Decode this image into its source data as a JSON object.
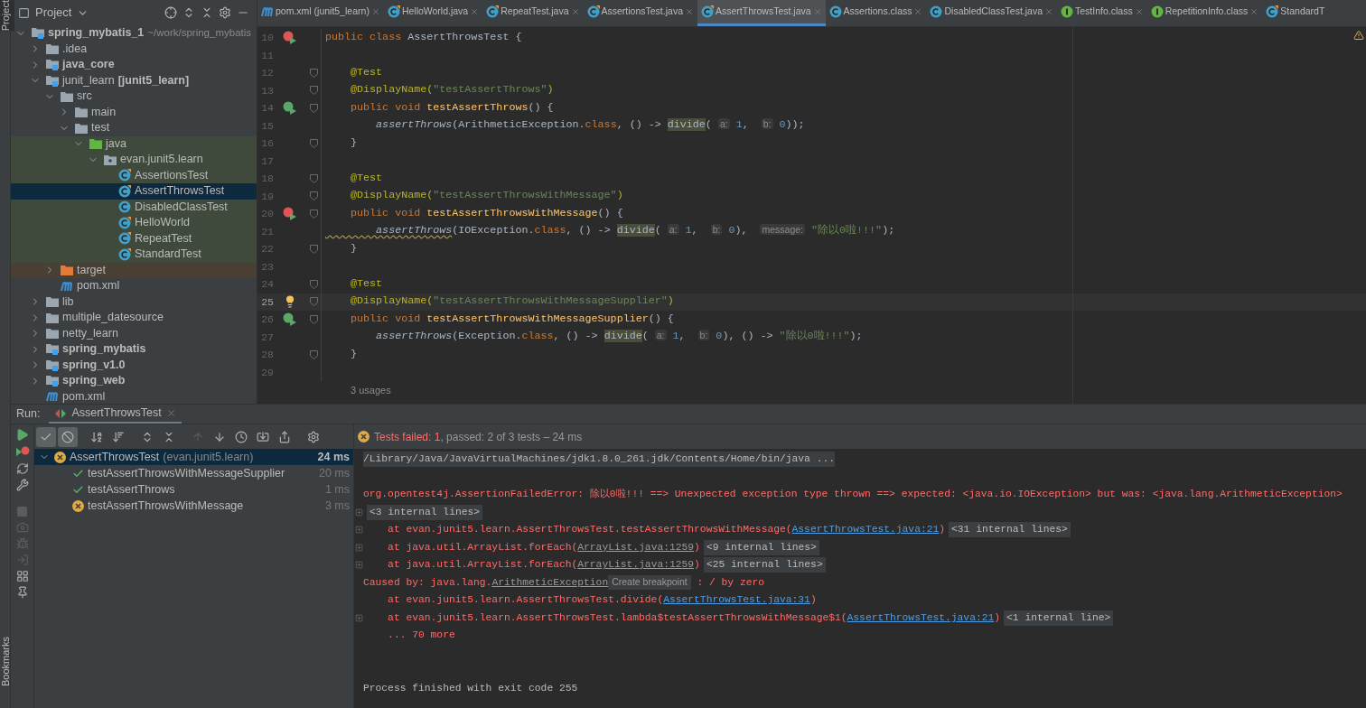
{
  "side_tools": {
    "top": "Project",
    "bottom": "Bookmarks"
  },
  "project_panel": {
    "title": "Project"
  },
  "project_tree": [
    {
      "name": "spring_mybatis_1",
      "suffix": "~/work/spring_mybatis",
      "kind": "module",
      "bold": true,
      "expanded": true,
      "selected": false,
      "children": [
        {
          "name": ".idea",
          "kind": "folder",
          "expanded": false,
          "selected": false
        },
        {
          "name": "java_core",
          "kind": "module",
          "bold": true,
          "expanded": false,
          "selected": false
        },
        {
          "name": "junit_learn",
          "suffix": "[junit5_learn]",
          "kind": "module",
          "expanded": true,
          "selected": false,
          "children": [
            {
              "name": "src",
              "kind": "folder",
              "expanded": true,
              "selected": false,
              "children": [
                {
                  "name": "main",
                  "kind": "folder",
                  "expanded": false,
                  "selected": false
                },
                {
                  "name": "test",
                  "kind": "folder",
                  "expanded": true,
                  "selected": false,
                  "children": [
                    {
                      "name": "java",
                      "kind": "test-folder",
                      "test_source": true,
                      "expanded": true,
                      "selected": false,
                      "children": [
                        {
                          "name": "evan.junit5.learn",
                          "kind": "package",
                          "test_source": true,
                          "expanded": true,
                          "selected": false,
                          "children": [
                            {
                              "name": "AssertionsTest",
                              "kind": "test-class",
                              "test_source": true,
                              "selected": false
                            },
                            {
                              "name": "AssertThrowsTest",
                              "kind": "test-class",
                              "test_source": true,
                              "selected": true
                            },
                            {
                              "name": "DisabledClassTest",
                              "kind": "class",
                              "test_source": true,
                              "selected": false
                            },
                            {
                              "name": "HelloWorld",
                              "kind": "test-class",
                              "test_source": true,
                              "selected": false
                            },
                            {
                              "name": "RepeatTest",
                              "kind": "test-class",
                              "test_source": true,
                              "selected": false
                            },
                            {
                              "name": "StandardTest",
                              "kind": "test-class",
                              "test_source": true,
                              "selected": false
                            }
                          ]
                        }
                      ]
                    }
                  ]
                }
              ]
            },
            {
              "name": "target",
              "kind": "excluded-folder",
              "excluded": true,
              "expanded": false,
              "selected": false
            },
            {
              "name": "pom.xml",
              "kind": "maven",
              "selected": false
            }
          ]
        },
        {
          "name": "lib",
          "kind": "folder",
          "expanded": false,
          "selected": false
        },
        {
          "name": "multiple_datesource",
          "kind": "folder",
          "expanded": false,
          "selected": false
        },
        {
          "name": "netty_learn",
          "kind": "folder",
          "expanded": false,
          "selected": false
        },
        {
          "name": "spring_mybatis",
          "kind": "module",
          "bold": true,
          "expanded": false,
          "selected": false
        },
        {
          "name": "spring_v1.0",
          "kind": "module",
          "bold": true,
          "expanded": false,
          "selected": false
        },
        {
          "name": "spring_web",
          "kind": "module",
          "bold": true,
          "expanded": false,
          "selected": false
        },
        {
          "name": "pom.xml",
          "kind": "maven",
          "selected": false
        }
      ]
    }
  ],
  "tabs": [
    {
      "label": "pom.xml (junit5_learn)",
      "kind": "maven",
      "selected": false
    },
    {
      "label": "HelloWorld.java",
      "kind": "test-class",
      "selected": false
    },
    {
      "label": "RepeatTest.java",
      "kind": "test-class",
      "selected": false
    },
    {
      "label": "AssertionsTest.java",
      "kind": "test-class",
      "selected": false
    },
    {
      "label": "AssertThrowsTest.java",
      "kind": "test-class",
      "selected": true
    },
    {
      "label": "Assertions.class",
      "kind": "class",
      "selected": false
    },
    {
      "label": "DisabledClassTest.java",
      "kind": "class",
      "selected": false
    },
    {
      "label": "TestInfo.class",
      "kind": "interface",
      "selected": false
    },
    {
      "label": "RepetitionInfo.class",
      "kind": "interface",
      "selected": false
    },
    {
      "label": "StandardT",
      "kind": "test-class",
      "selected": false
    }
  ],
  "editor": {
    "lines": [
      {
        "number": "10",
        "gutter": {
          "kind": "run-failed"
        },
        "tokens": [
          {
            "text": "public class ",
            "kind": "kw"
          },
          {
            "text": "AssertThrowsTest {",
            "kind": "plain"
          }
        ]
      },
      {
        "number": "11"
      },
      {
        "number": "12",
        "fold": true,
        "tokens": [
          {
            "text": "    @Test",
            "kind": "ann"
          }
        ]
      },
      {
        "number": "13",
        "fold": true,
        "tokens": [
          {
            "text": "    @DisplayName(",
            "kind": "ann"
          },
          {
            "text": "\"testAssertThrows\"",
            "kind": "str"
          },
          {
            "text": ")",
            "kind": "ann"
          }
        ]
      },
      {
        "number": "14",
        "gutter": {
          "kind": "run-passed"
        },
        "fold": true,
        "tokens": [
          {
            "text": "    public void ",
            "kind": "kw"
          },
          {
            "text": "testAssertThrows",
            "kind": "fn"
          },
          {
            "text": "() {",
            "kind": "plain"
          }
        ]
      },
      {
        "number": "15",
        "tokens": [
          {
            "text": "        assertThrows",
            "kind": "call"
          },
          {
            "text": "(ArithmeticException.",
            "kind": "plain"
          },
          {
            "text": "class",
            "kind": "kw"
          },
          {
            "text": ", () -> ",
            "kind": "plain"
          },
          {
            "text": "divide",
            "kind": "hl"
          },
          {
            "text": "( ",
            "kind": "plain"
          },
          {
            "text": "a:",
            "kind": "hint"
          },
          {
            "text": " 1",
            "kind": "num"
          },
          {
            "text": ",  ",
            "kind": "plain"
          },
          {
            "text": "b:",
            "kind": "hint"
          },
          {
            "text": " 0",
            "kind": "num"
          },
          {
            "text": "));",
            "kind": "plain"
          }
        ]
      },
      {
        "number": "16",
        "fold": true,
        "tokens": [
          {
            "text": "    }",
            "kind": "plain"
          }
        ]
      },
      {
        "number": "17"
      },
      {
        "number": "18",
        "fold": true,
        "tokens": [
          {
            "text": "    @Test",
            "kind": "ann"
          }
        ]
      },
      {
        "number": "19",
        "fold": true,
        "tokens": [
          {
            "text": "    @DisplayName(",
            "kind": "ann"
          },
          {
            "text": "\"testAssertThrowsWithMessage\"",
            "kind": "str"
          },
          {
            "text": ")",
            "kind": "ann"
          }
        ]
      },
      {
        "number": "20",
        "gutter": {
          "kind": "run-failed"
        },
        "fold": true,
        "tokens": [
          {
            "text": "    public void ",
            "kind": "kw"
          },
          {
            "text": "testAssertThrowsWithMessage",
            "kind": "fn"
          },
          {
            "text": "() {",
            "kind": "plain"
          }
        ]
      },
      {
        "number": "21",
        "tokens": [
          {
            "text": "        assertThrows",
            "kind": "call-warn"
          },
          {
            "text": "(IOException.",
            "kind": "plain"
          },
          {
            "text": "class",
            "kind": "kw"
          },
          {
            "text": ", () -> ",
            "kind": "plain"
          },
          {
            "text": "divide",
            "kind": "hl"
          },
          {
            "text": "( ",
            "kind": "plain"
          },
          {
            "text": "a:",
            "kind": "hint"
          },
          {
            "text": " 1",
            "kind": "num"
          },
          {
            "text": ",  ",
            "kind": "plain"
          },
          {
            "text": "b:",
            "kind": "hint"
          },
          {
            "text": " 0",
            "kind": "num"
          },
          {
            "text": "),  ",
            "kind": "plain"
          },
          {
            "text": "message:",
            "kind": "hint"
          },
          {
            "text": " \"除以0啦!!!\"",
            "kind": "str"
          },
          {
            "text": ");",
            "kind": "plain"
          }
        ]
      },
      {
        "number": "22",
        "fold": true,
        "tokens": [
          {
            "text": "    }",
            "kind": "plain"
          }
        ]
      },
      {
        "number": "23"
      },
      {
        "number": "24",
        "fold": true,
        "tokens": [
          {
            "text": "    @Test",
            "kind": "ann"
          }
        ]
      },
      {
        "number": "25",
        "gutter": {
          "kind": "bulb"
        },
        "current": true,
        "fold": true,
        "tokens": [
          {
            "text": "    @DisplayName(",
            "kind": "ann"
          },
          {
            "text": "\"testAssertThrowsWithMessageSupplier\"",
            "kind": "str"
          },
          {
            "text": ")",
            "kind": "ann"
          }
        ]
      },
      {
        "number": "26",
        "gutter": {
          "kind": "run-passed"
        },
        "fold": true,
        "tokens": [
          {
            "text": "    public void ",
            "kind": "kw"
          },
          {
            "text": "testAssertThrowsWithMessageSupplier",
            "kind": "fn"
          },
          {
            "text": "() {",
            "kind": "plain"
          }
        ]
      },
      {
        "number": "27",
        "tokens": [
          {
            "text": "        assertThrows",
            "kind": "call"
          },
          {
            "text": "(Exception.",
            "kind": "plain"
          },
          {
            "text": "class",
            "kind": "kw"
          },
          {
            "text": ", () -> ",
            "kind": "plain"
          },
          {
            "text": "divide",
            "kind": "hl"
          },
          {
            "text": "( ",
            "kind": "plain"
          },
          {
            "text": "a:",
            "kind": "hint"
          },
          {
            "text": " 1",
            "kind": "num"
          },
          {
            "text": ",  ",
            "kind": "plain"
          },
          {
            "text": "b:",
            "kind": "hint"
          },
          {
            "text": " 0",
            "kind": "num"
          },
          {
            "text": "), () -> ",
            "kind": "plain"
          },
          {
            "text": "\"除以0啦!!!\"",
            "kind": "str"
          },
          {
            "text": ");",
            "kind": "plain"
          }
        ]
      },
      {
        "number": "28",
        "fold": true,
        "tokens": [
          {
            "text": "    }",
            "kind": "plain"
          }
        ]
      },
      {
        "number": "29"
      }
    ],
    "usages": "3 usages"
  },
  "run_panel": {
    "label": "Run:",
    "tab": "AssertThrowsTest",
    "show_passed": true,
    "show_ignored": true,
    "status": {
      "failed": "Tests failed: 1",
      "rest": ", passed: 2 of 3 tests – 24 ms"
    },
    "tests": [
      {
        "name": "AssertThrowsTest",
        "package": "(evan.junit5.learn)",
        "time": "24 ms",
        "failed": true,
        "expanded": true,
        "selected": true,
        "children": [
          {
            "name": "testAssertThrowsWithMessageSupplier",
            "time": "20 ms",
            "failed": false,
            "selected": false
          },
          {
            "name": "testAssertThrows",
            "time": "1 ms",
            "failed": false,
            "selected": false
          },
          {
            "name": "testAssertThrowsWithMessage",
            "time": "3 ms",
            "failed": true,
            "selected": false
          }
        ]
      }
    ],
    "console": [
      {
        "kind": "text",
        "parts": [
          {
            "text": "/Library/Java/JavaVirtualMachines/jdk1.8.0_261.jdk/Contents/Home/bin/java ...",
            "kind": "cmd"
          }
        ]
      },
      {
        "kind": "blank"
      },
      {
        "kind": "text",
        "parts": [
          {
            "text": "org.opentest4j.AssertionFailedError: 除以0啦!!! ==> Unexpected exception type thrown ==> expected: <java.io.IOException> but was: <java.lang.ArithmeticException>",
            "kind": "err"
          }
        ]
      },
      {
        "kind": "text",
        "fold": true,
        "parts": [
          {
            "text": "<3 internal lines>",
            "kind": "chip"
          }
        ]
      },
      {
        "kind": "text",
        "fold": true,
        "parts": [
          {
            "text": "    at evan.junit5.learn.AssertThrowsTest.testAssertThrowsWithMessage(",
            "kind": "err"
          },
          {
            "text": "AssertThrowsTest.java:21",
            "kind": "link"
          },
          {
            "text": ")",
            "kind": "err"
          },
          {
            "text": "<31 internal lines>",
            "kind": "chip"
          }
        ]
      },
      {
        "kind": "text",
        "fold": true,
        "parts": [
          {
            "text": "    at java.util.ArrayList.forEach(",
            "kind": "err"
          },
          {
            "text": "ArrayList.java:1259",
            "kind": "link-grey"
          },
          {
            "text": ")",
            "kind": "err"
          },
          {
            "text": "<9 internal lines>",
            "kind": "chip"
          }
        ]
      },
      {
        "kind": "text",
        "fold": true,
        "parts": [
          {
            "text": "    at java.util.ArrayList.forEach(",
            "kind": "err"
          },
          {
            "text": "ArrayList.java:1259",
            "kind": "link-grey"
          },
          {
            "text": ")",
            "kind": "err"
          },
          {
            "text": "<25 internal lines>",
            "kind": "chip"
          }
        ]
      },
      {
        "kind": "text",
        "parts": [
          {
            "text": "Caused by: java.lang.",
            "kind": "err"
          },
          {
            "text": "ArithmeticException",
            "kind": "link-grey"
          },
          {
            "text": "Create breakpoint",
            "kind": "hint"
          },
          {
            "text": " : / by zero",
            "kind": "err"
          }
        ]
      },
      {
        "kind": "text",
        "parts": [
          {
            "text": "    at evan.junit5.learn.AssertThrowsTest.divide(",
            "kind": "err"
          },
          {
            "text": "AssertThrowsTest.java:31",
            "kind": "link"
          },
          {
            "text": ")",
            "kind": "err"
          }
        ]
      },
      {
        "kind": "text",
        "fold": true,
        "parts": [
          {
            "text": "    at evan.junit5.learn.AssertThrowsTest.lambda$testAssertThrowsWithMessage$1(",
            "kind": "err"
          },
          {
            "text": "AssertThrowsTest.java:21",
            "kind": "link"
          },
          {
            "text": ")",
            "kind": "err"
          },
          {
            "text": "<1 internal line>",
            "kind": "chip"
          }
        ]
      },
      {
        "kind": "text",
        "parts": [
          {
            "text": "    ... 70 more",
            "kind": "err"
          }
        ]
      },
      {
        "kind": "blank"
      },
      {
        "kind": "blank"
      },
      {
        "kind": "text",
        "parts": [
          {
            "text": "Process finished with exit code 255",
            "kind": "plain"
          }
        ]
      }
    ]
  }
}
